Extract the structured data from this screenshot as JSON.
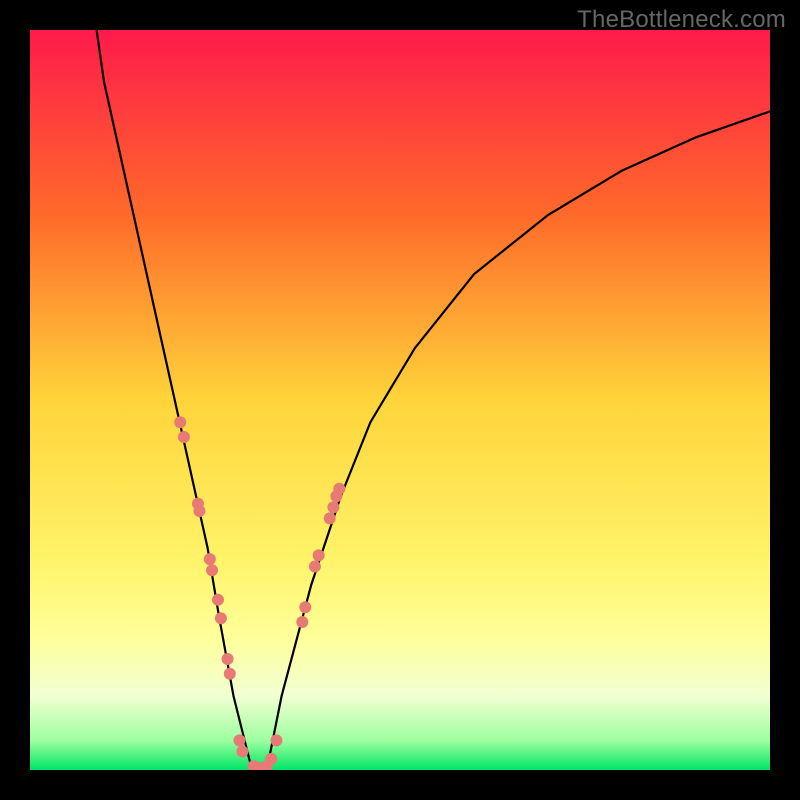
{
  "watermark": "TheBottleneck.com",
  "chart_data": {
    "type": "line",
    "title": "",
    "xlabel": "",
    "ylabel": "",
    "xlim": [
      0,
      100
    ],
    "ylim": [
      0,
      100
    ],
    "background": {
      "type": "vertical-gradient",
      "stops": [
        {
          "offset": 0,
          "color": "#ff1a4b"
        },
        {
          "offset": 25,
          "color": "#ff6a2a"
        },
        {
          "offset": 50,
          "color": "#ffd43a"
        },
        {
          "offset": 72,
          "color": "#fff46a"
        },
        {
          "offset": 82,
          "color": "#ffff9a"
        },
        {
          "offset": 90,
          "color": "#f2ffd2"
        },
        {
          "offset": 96,
          "color": "#9effa0"
        },
        {
          "offset": 100,
          "color": "#00e566"
        }
      ]
    },
    "series": [
      {
        "name": "bottleneck-curve",
        "x": [
          9,
          10,
          12,
          14,
          16,
          18,
          20,
          22,
          24,
          25.5,
          27.5,
          30,
          32,
          34,
          38,
          42,
          46,
          52,
          60,
          70,
          80,
          90,
          100
        ],
        "values": [
          100,
          93,
          84,
          75,
          66,
          57,
          48,
          39,
          30,
          21,
          10,
          0,
          0,
          10,
          25,
          37,
          47,
          57,
          67,
          75,
          81,
          85.5,
          89
        ]
      }
    ],
    "markers": {
      "name": "highlight-points",
      "color": "#e77a74",
      "radius_px": 6,
      "points": [
        {
          "x": 20.3,
          "y": 47
        },
        {
          "x": 20.8,
          "y": 45
        },
        {
          "x": 22.7,
          "y": 36
        },
        {
          "x": 22.9,
          "y": 35
        },
        {
          "x": 24.3,
          "y": 28.5
        },
        {
          "x": 24.6,
          "y": 27
        },
        {
          "x": 25.4,
          "y": 23
        },
        {
          "x": 25.8,
          "y": 20.5
        },
        {
          "x": 26.7,
          "y": 15
        },
        {
          "x": 27.0,
          "y": 13
        },
        {
          "x": 28.3,
          "y": 4
        },
        {
          "x": 28.7,
          "y": 2.5
        },
        {
          "x": 30.2,
          "y": 0.5
        },
        {
          "x": 30.8,
          "y": 0.3
        },
        {
          "x": 32.0,
          "y": 0.5
        },
        {
          "x": 32.6,
          "y": 1.5
        },
        {
          "x": 33.3,
          "y": 4
        },
        {
          "x": 36.8,
          "y": 20
        },
        {
          "x": 37.2,
          "y": 22
        },
        {
          "x": 38.5,
          "y": 27.5
        },
        {
          "x": 39.0,
          "y": 29
        },
        {
          "x": 40.5,
          "y": 34
        },
        {
          "x": 41.0,
          "y": 35.5
        },
        {
          "x": 41.4,
          "y": 37
        },
        {
          "x": 41.8,
          "y": 38
        }
      ]
    }
  }
}
